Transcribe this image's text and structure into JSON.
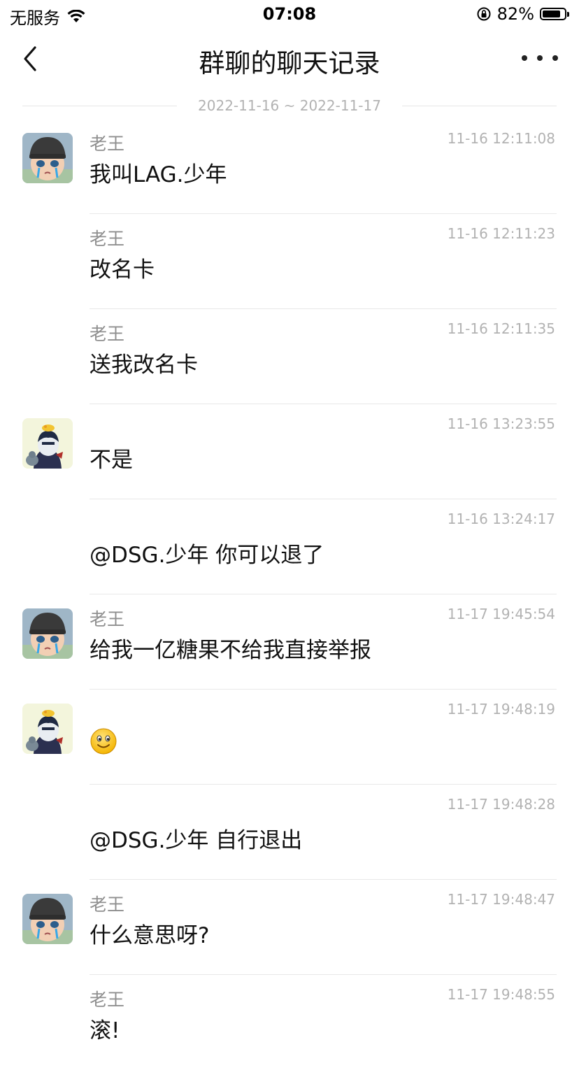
{
  "status_bar": {
    "carrier": "无服务",
    "time": "07:08",
    "battery_percent": "82%",
    "battery_level": 0.82
  },
  "nav": {
    "title": "群聊的聊天记录",
    "back_icon": "chevron-left-icon",
    "more_icon": "more-dots-icon"
  },
  "date_range": "2022-11-16 ~ 2022-11-17",
  "messages": [
    {
      "sender": "老王",
      "time": "11-16 12:11:08",
      "text": "我叫LAG.少年",
      "avatar": "avatar-laowang"
    },
    {
      "sender": "老王",
      "time": "11-16 12:11:23",
      "text": "改名卡",
      "avatar": ""
    },
    {
      "sender": "老王",
      "time": "11-16 12:11:35",
      "text": "送我改名卡",
      "avatar": ""
    },
    {
      "sender": "",
      "time": "11-16 13:23:55",
      "text": "不是",
      "avatar": "avatar-other"
    },
    {
      "sender": "",
      "time": "11-16 13:24:17",
      "text": "@DSG.少年 你可以退了",
      "avatar": ""
    },
    {
      "sender": "老王",
      "time": "11-17 19:45:54",
      "text": "给我一亿糖果不给我直接举报",
      "avatar": "avatar-laowang"
    },
    {
      "sender": "",
      "time": "11-17 19:48:19",
      "text": "",
      "avatar": "avatar-other",
      "emoji": "smiley-emoji"
    },
    {
      "sender": "",
      "time": "11-17 19:48:28",
      "text": "@DSG.少年 自行退出",
      "avatar": ""
    },
    {
      "sender": "老王",
      "time": "11-17 19:48:47",
      "text": "什么意思呀?",
      "avatar": "avatar-laowang"
    },
    {
      "sender": "老王",
      "time": "11-17 19:48:55",
      "text": "滚!",
      "avatar": ""
    }
  ]
}
